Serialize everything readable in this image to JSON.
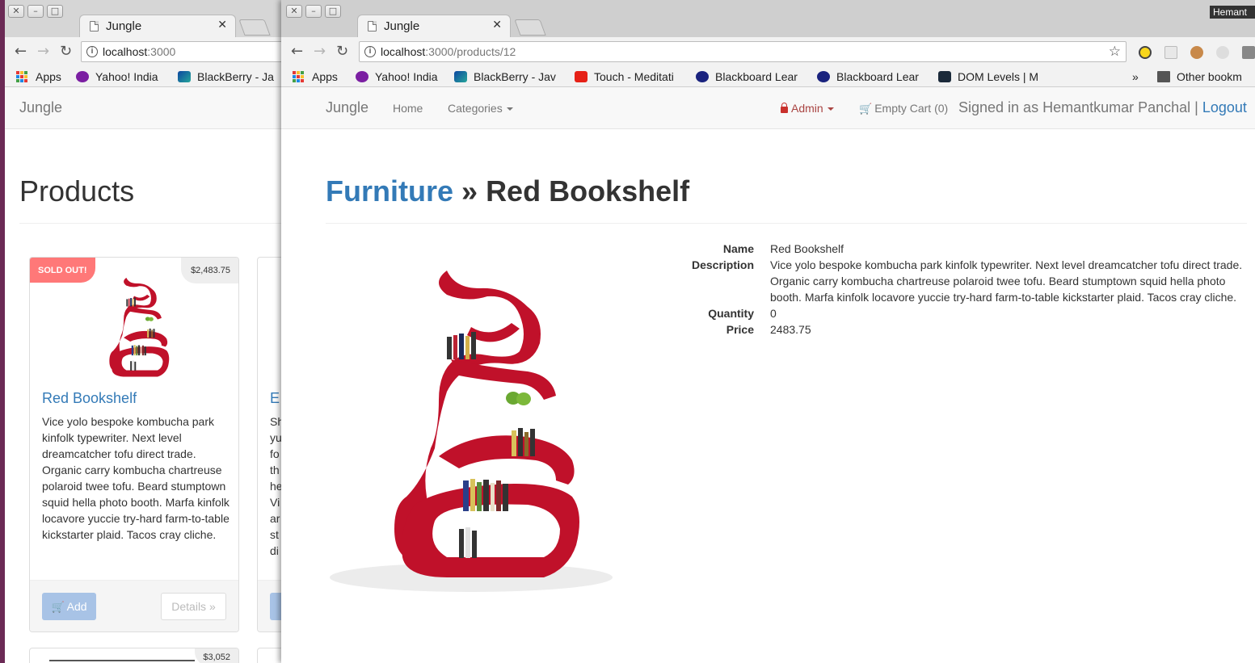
{
  "back_window": {
    "tab_title": "Jungle",
    "url_host": "localhost",
    "url_port": ":3000",
    "bookmarks": [
      "Apps",
      "Yahoo! India",
      "BlackBerry - Ja"
    ],
    "brand": "Jungle",
    "page_title": "Products",
    "products": [
      {
        "badge": "SOLD OUT!",
        "price": "$2,483.75",
        "name": "Red Bookshelf",
        "description": "Vice yolo bespoke kombucha park kinfolk typewriter. Next level dreamcatcher tofu direct trade. Organic carry kombucha chartreuse polaroid twee tofu. Beard stumptown squid hella photo booth. Marfa kinfolk locavore yuccie try-hard farm-to-table kickstarter plaid. Tacos cray cliche.",
        "add_label": "Add",
        "details_label": "Details »"
      },
      {
        "name": "E",
        "description_fragments": [
          "Sh",
          "yu",
          "fo",
          "th",
          "he",
          "Vi",
          "ar",
          "st",
          "di"
        ]
      },
      {
        "price": "$3,052"
      }
    ]
  },
  "front_window": {
    "tab_title": "Jungle",
    "url_host": "localhost",
    "url_path": ":3000/products/12",
    "bookmarks": [
      "Apps",
      "Yahoo! India",
      "BlackBerry - Jav",
      "Touch - Meditati",
      "Blackboard Lear",
      "Blackboard Lear",
      "DOM Levels | M",
      "»",
      "Other bookm"
    ],
    "os_user_label": "Hemant",
    "nav": {
      "brand": "Jungle",
      "home": "Home",
      "categories": "Categories",
      "admin": "Admin",
      "cart": "Empty Cart (0)",
      "signed_in": "Signed in as Hemantkumar Panchal",
      "separator": "|",
      "logout": "Logout"
    },
    "breadcrumb": {
      "category": "Furniture",
      "separator": "»",
      "product": "Red Bookshelf"
    },
    "details": [
      {
        "label": "Name",
        "value": "Red Bookshelf"
      },
      {
        "label": "Description",
        "value": "Vice yolo bespoke kombucha park kinfolk typewriter. Next level dreamcatcher tofu direct trade. Organic carry kombucha chartreuse polaroid twee tofu. Beard stumptown squid hella photo booth. Marfa kinfolk locavore yuccie try-hard farm-to-table kickstarter plaid. Tacos cray cliche."
      },
      {
        "label": "Quantity",
        "value": "0"
      },
      {
        "label": "Price",
        "value": "2483.75"
      }
    ]
  },
  "colors": {
    "link": "#337ab7",
    "sold_badge": "#ff7878",
    "admin": "#a94442",
    "bookshelf": "#c0112a"
  }
}
